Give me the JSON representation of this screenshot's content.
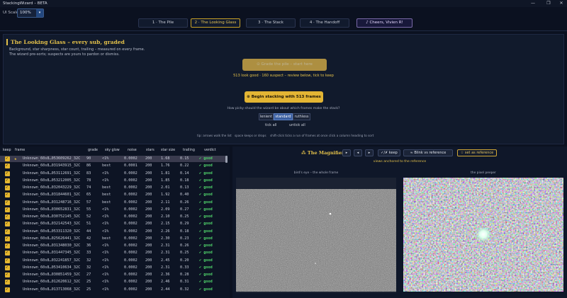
{
  "window": {
    "title": "StackingWizard – BETA",
    "controls": [
      "—",
      "❐",
      "✕"
    ]
  },
  "toolbar": {
    "ui_scale_label": "UI Scale",
    "ui_scale_value": "100%"
  },
  "tabs": [
    {
      "label": "1 · The Pile",
      "active": false
    },
    {
      "label": "2 · The Looking Glass",
      "active": true
    },
    {
      "label": "3 · The Stack",
      "active": false
    },
    {
      "label": "4 · The Handoff",
      "active": false
    }
  ],
  "cheers_label": "♪ Cheers, Vivien R!",
  "looking_glass": {
    "title": "The Looking Glass – every sub, graded",
    "desc_line1": "Background, star sharpness, star count, trailing – measured on every frame.",
    "desc_line2": "The wizard pre-sorts; suspects are yours to pardon or dismiss.",
    "grade_button": "⊙  Grade the pile – start here",
    "summary": "513 look good · 160 suspect – review below, tick to keep",
    "stack_button": "⊛  Begin stacking with 513 frames →",
    "strictness_question": "How picky should the wizard be about which frames make the stack?",
    "strictness_options": [
      {
        "label": "lenient",
        "active": false
      },
      {
        "label": "standard",
        "active": true
      },
      {
        "label": "ruthless",
        "active": false
      }
    ],
    "tick_all": "tick all",
    "untick_all": "untick all",
    "tip1": "tip: arrows walk the list",
    "tip2": "space keeps or drops",
    "tip3": "shift-click ticks a run of frames at once",
    "tip4": "click a column heading to sort"
  },
  "table": {
    "columns": [
      "keep",
      "frame",
      "grade",
      "sky glow",
      "noise",
      "stars",
      "star size",
      "trailing",
      "verdict"
    ],
    "rows": [
      {
        "frame": "Unknown_60s8…053609262_32C",
        "grade": "90",
        "sky": "<1%",
        "noise": "0.0002",
        "stars": "200",
        "size": "1.68",
        "trail": "0.15",
        "verdict": "✔ good",
        "starred": true
      },
      {
        "frame": "Unknown_60s8…031943915_32C",
        "grade": "86",
        "sky": "best",
        "noise": "0.0001",
        "stars": "200",
        "size": "1.76",
        "trail": "0.22",
        "verdict": "✔ good",
        "starred": false
      },
      {
        "frame": "Unknown_60s8…053112691_32C",
        "grade": "83",
        "sky": "<1%",
        "noise": "0.0002",
        "stars": "200",
        "size": "1.81",
        "trail": "0.14",
        "verdict": "✔ good",
        "starred": false
      },
      {
        "frame": "Unknown_60s8…053212005_32C",
        "grade": "78",
        "sky": "<1%",
        "noise": "0.0002",
        "stars": "200",
        "size": "1.85",
        "trail": "0.18",
        "verdict": "✔ good",
        "starred": false
      },
      {
        "frame": "Unknown_60s8…032043229_32C",
        "grade": "74",
        "sky": "best",
        "noise": "0.0002",
        "stars": "200",
        "size": "2.01",
        "trail": "0.13",
        "verdict": "✔ good",
        "starred": false
      },
      {
        "frame": "Unknown_60s8…031844601_32C",
        "grade": "65",
        "sky": "best",
        "noise": "0.0002",
        "stars": "200",
        "size": "1.92",
        "trail": "0.40",
        "verdict": "✔ good",
        "starred": false
      },
      {
        "frame": "Unknown_60s8…031248716_32C",
        "grade": "57",
        "sky": "best",
        "noise": "0.0002",
        "stars": "200",
        "size": "2.11",
        "trail": "0.26",
        "verdict": "✔ good",
        "starred": false
      },
      {
        "frame": "Unknown_60s8…030652831_32C",
        "grade": "55",
        "sky": "<1%",
        "noise": "0.0002",
        "stars": "200",
        "size": "2.09",
        "trail": "0.27",
        "verdict": "✔ good",
        "starred": false
      },
      {
        "frame": "Unknown_60s8…030752145_32C",
        "grade": "52",
        "sky": "<1%",
        "noise": "0.0002",
        "stars": "200",
        "size": "2.10",
        "trail": "0.25",
        "verdict": "✔ good",
        "starred": false
      },
      {
        "frame": "Unknown_60s8…032142543_32C",
        "grade": "51",
        "sky": "<1%",
        "noise": "0.0002",
        "stars": "200",
        "size": "2.15",
        "trail": "0.29",
        "verdict": "✔ good",
        "starred": false
      },
      {
        "frame": "Unknown_60s8…053311320_32C",
        "grade": "44",
        "sky": "<1%",
        "noise": "0.0002",
        "stars": "200",
        "size": "2.26",
        "trail": "0.18",
        "verdict": "✔ good",
        "starred": false
      },
      {
        "frame": "Unknown_60s8…025626441_32C",
        "grade": "42",
        "sky": "best",
        "noise": "0.0002",
        "stars": "200",
        "size": "2.30",
        "trail": "0.23",
        "verdict": "✔ good",
        "starred": false
      },
      {
        "frame": "Unknown_60s8…031348030_32C",
        "grade": "36",
        "sky": "<1%",
        "noise": "0.0002",
        "stars": "200",
        "size": "2.31",
        "trail": "0.26",
        "verdict": "✔ good",
        "starred": false
      },
      {
        "frame": "Unknown_60s8…031447345_32C",
        "grade": "33",
        "sky": "<1%",
        "noise": "0.0002",
        "stars": "200",
        "size": "2.31",
        "trail": "0.25",
        "verdict": "✔ good",
        "starred": false
      },
      {
        "frame": "Unknown_60s8…032241857_32C",
        "grade": "32",
        "sky": "<1%",
        "noise": "0.0002",
        "stars": "200",
        "size": "2.45",
        "trail": "0.20",
        "verdict": "✔ good",
        "starred": false
      },
      {
        "frame": "Unknown_60s8…053410634_32C",
        "grade": "32",
        "sky": "<1%",
        "noise": "0.0002",
        "stars": "200",
        "size": "2.31",
        "trail": "0.33",
        "verdict": "✔ good",
        "starred": false
      },
      {
        "frame": "Unknown_60s8…030851459_32C",
        "grade": "27",
        "sky": "<1%",
        "noise": "0.0002",
        "stars": "200",
        "size": "2.36",
        "trail": "0.28",
        "verdict": "✔ good",
        "starred": false
      },
      {
        "frame": "Unknown_60s8…012620612_32C",
        "grade": "25",
        "sky": "<1%",
        "noise": "0.0002",
        "stars": "200",
        "size": "2.46",
        "trail": "0.31",
        "verdict": "✔ good",
        "starred": false
      },
      {
        "frame": "Unknown_60s8…013713068_32C",
        "grade": "25",
        "sky": "<1%",
        "noise": "0.0002",
        "stars": "200",
        "size": "2.44",
        "trail": "0.32",
        "verdict": "✔ good",
        "starred": false
      }
    ]
  },
  "magnifier": {
    "title": "⁂ The Magnifier",
    "keep_label": "✓/✗ keep",
    "blink_label": "≈ Blink vs reference",
    "set_ref_label": "☆ set as reference",
    "anchored_text": "views anchored to the reference",
    "view1_label": "bird's eye – the whole frame",
    "view2_label": "the pixel peeper"
  },
  "colors": {
    "accent_gold": "#e3c04a",
    "good_green": "#4fd26a",
    "background": "#0b1120"
  }
}
